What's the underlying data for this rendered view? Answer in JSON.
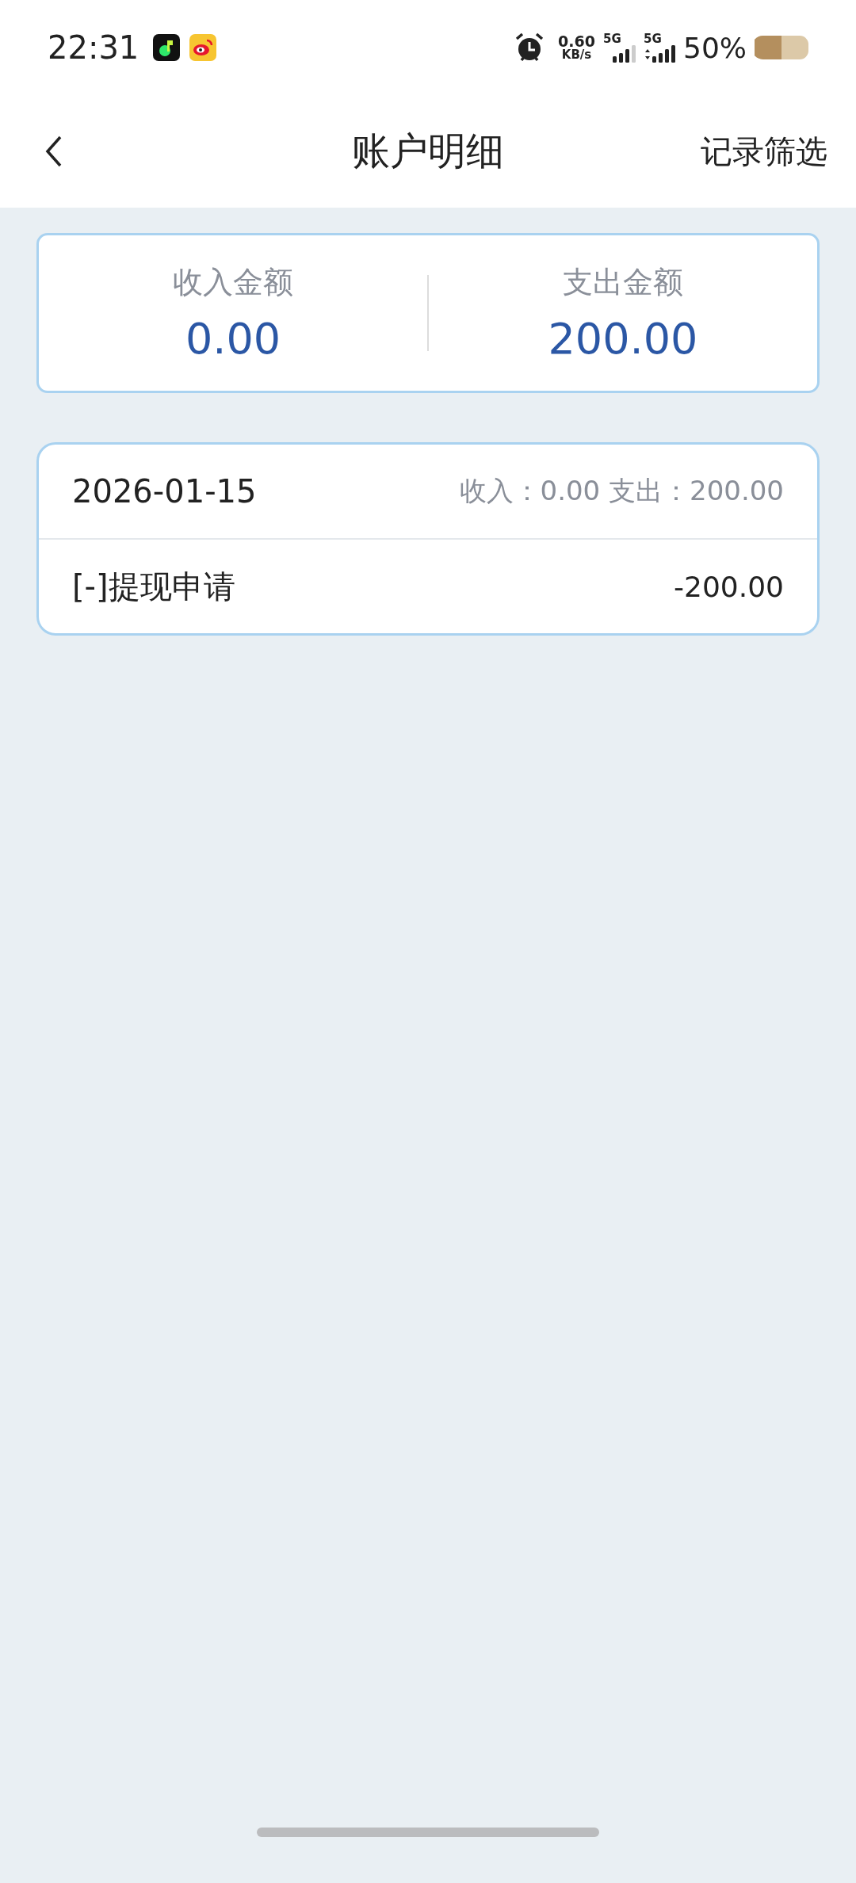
{
  "status_bar": {
    "time": "22:31",
    "speed": "0.60",
    "speed_unit": "KB/s",
    "sim_1": "5G",
    "sim_2": "5G",
    "battery": "50%"
  },
  "nav": {
    "title": "账户明细",
    "action": "记录筛选"
  },
  "summary": [
    {
      "label": "收入金额",
      "amount": "0.00"
    },
    {
      "label": "支出金额",
      "amount": "200.00"
    }
  ],
  "days": [
    {
      "date": "2026-01-15",
      "totals": "收入：0.00 支出：200.00",
      "records": [
        {
          "title": "[-]提现申请",
          "amount": "-200.00"
        }
      ]
    }
  ]
}
